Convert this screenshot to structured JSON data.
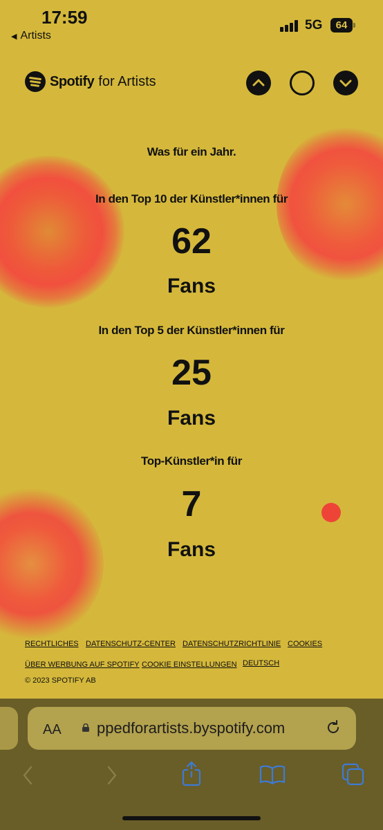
{
  "status_bar": {
    "time": "17:59",
    "back_app": "Artists",
    "network": "5G",
    "battery": "64"
  },
  "header": {
    "brand": "Spotify",
    "brand_suffix": "for Artists",
    "brand_color": "#111111"
  },
  "main": {
    "intro": "Was für ein Jahr.",
    "stats": [
      {
        "label": "In den Top 10 der Künstler*innen für",
        "value": "62",
        "unit": "Fans"
      },
      {
        "label": "In den Top 5 der Künstler*innen für",
        "value": "25",
        "unit": "Fans"
      },
      {
        "label": "Top-Künstler*in für",
        "value": "7",
        "unit": "Fans"
      }
    ]
  },
  "footer": {
    "links": [
      "RECHTLICHES",
      "DATENSCHUTZ-CENTER",
      "DATENSCHUTZRICHTLINIE",
      "COOKIES",
      "ÜBER WERBUNG AUF SPOTIFY",
      "COOKIE EINSTELLUNGEN",
      "DEUTSCH"
    ],
    "copyright": "© 2023 SPOTIFY AB"
  },
  "browser": {
    "text_size_label": "AA",
    "url": "ppedforartists.byspotify.com"
  },
  "colors": {
    "background": "#d5b83b",
    "firework": "#ef5a3c",
    "text": "#111111",
    "toolbar_icon": "#3d7bd6"
  }
}
